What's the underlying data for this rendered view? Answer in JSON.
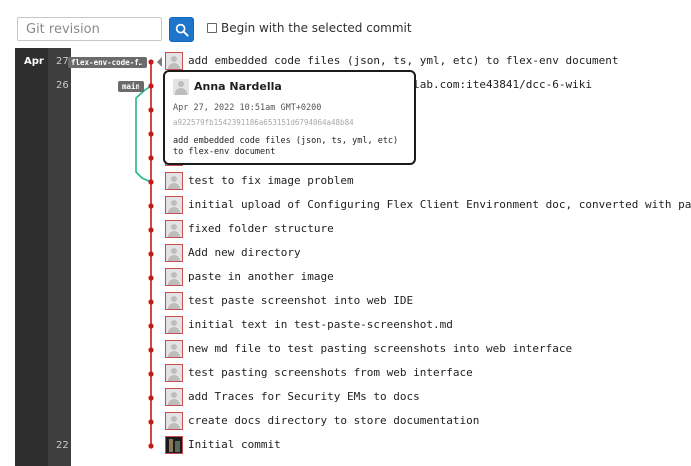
{
  "toolbar": {
    "search_placeholder": "Git revision",
    "checkbox_label": "Begin with the selected commit"
  },
  "timeline": {
    "month": "Apr",
    "days": [
      {
        "label": "27",
        "row": 0
      },
      {
        "label": "26",
        "row": 1
      },
      {
        "label": "22",
        "row": 16
      }
    ]
  },
  "refs": {
    "branch": "flex-env-code-f…",
    "main": "main"
  },
  "commits": [
    {
      "message": "add embedded code files (json, ts, yml, etc) to flex-env document",
      "avatar": "default-avatar"
    },
    {
      "message": "Merge branch 'main' of https://gitlab.com:ite43841/dcc-6-wiki",
      "avatar": "default-avatar"
    },
    {
      "message": "",
      "avatar": "default-avatar"
    },
    {
      "message": "",
      "avatar": "default-avatar"
    },
    {
      "message": "",
      "avatar": "default-avatar"
    },
    {
      "message": "test to fix image problem",
      "avatar": "default-avatar"
    },
    {
      "message": "initial upload of Configuring Flex Client Environment doc, converted with pandoc",
      "avatar": "default-avatar"
    },
    {
      "message": "fixed folder structure",
      "avatar": "default-avatar"
    },
    {
      "message": "Add new directory",
      "avatar": "default-avatar"
    },
    {
      "message": "paste in another image",
      "avatar": "default-avatar"
    },
    {
      "message": "test paste screenshot into web IDE",
      "avatar": "default-avatar"
    },
    {
      "message": "initial text in test-paste-screenshot.md",
      "avatar": "default-avatar"
    },
    {
      "message": "new md file to test pasting screenshots into web interface",
      "avatar": "default-avatar"
    },
    {
      "message": "test pasting screenshots from web interface",
      "avatar": "default-avatar"
    },
    {
      "message": "add Traces for Security EMs to docs",
      "avatar": "default-avatar"
    },
    {
      "message": "create docs directory to store documentation",
      "avatar": "default-avatar"
    },
    {
      "message": "Initial commit",
      "avatar": "photo-avatar"
    }
  ],
  "tooltip": {
    "author": "Anna Nardella",
    "date": "Apr 27, 2022 10:51am GMT+0200",
    "sha": "a922579fb1542391186a653151d6794064a48b84",
    "message": "add embedded code files (json, ts, yml, etc) to flex-env document"
  },
  "colors": {
    "main_line": "#c61a1a",
    "branch_line": "#1fb98b",
    "button": "#1f75cb"
  }
}
